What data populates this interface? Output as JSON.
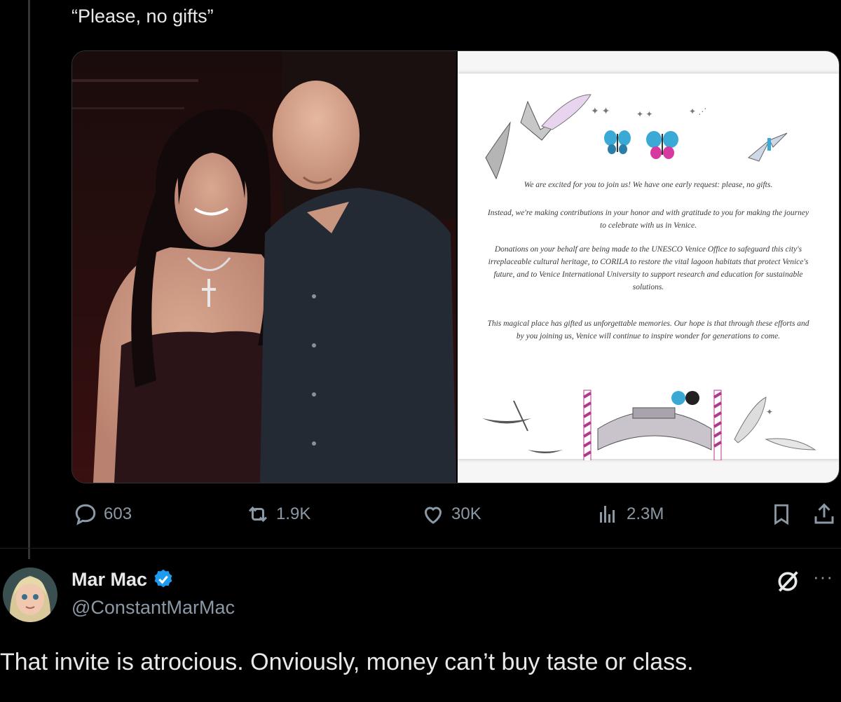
{
  "quoted_tweet": {
    "text": "“Please, no gifts”",
    "invitation": {
      "paragraph1": "We are excited for you to join us! We have one early request: please, no gifts.",
      "paragraph2": "Instead, we're making contributions in your honor and with gratitude to you for making the journey to celebrate with us in Venice.",
      "paragraph3": "Donations on your behalf are being made to the UNESCO Venice Office to safeguard this city's irreplaceable cultural heritage, to CORILA to restore the vital lagoon habitats that protect Venice's future, and to Venice International University to support research and education for sustainable solutions.",
      "paragraph4": "This magical place has gifted us unforgettable memories. Our hope is that through these efforts and by you joining us, Venice will continue to inspire wonder for generations to come."
    },
    "actions": {
      "replies": "603",
      "reposts": "1.9K",
      "likes": "30K",
      "views": "2.3M"
    }
  },
  "reply": {
    "display_name": "Mar Mac",
    "handle": "@ConstantMarMac",
    "text": "That invite is atrocious. Onviously, money can’t buy taste or class.",
    "verified": true
  },
  "colors": {
    "background": "#000000",
    "text_primary": "#e7e9ea",
    "text_secondary": "#8b98a5",
    "verified_blue": "#1d9bf0"
  },
  "icons": [
    "reply-icon",
    "repost-icon",
    "like-icon",
    "views-icon",
    "bookmark-icon",
    "share-icon",
    "verified-badge-icon",
    "grok-icon",
    "more-icon"
  ]
}
